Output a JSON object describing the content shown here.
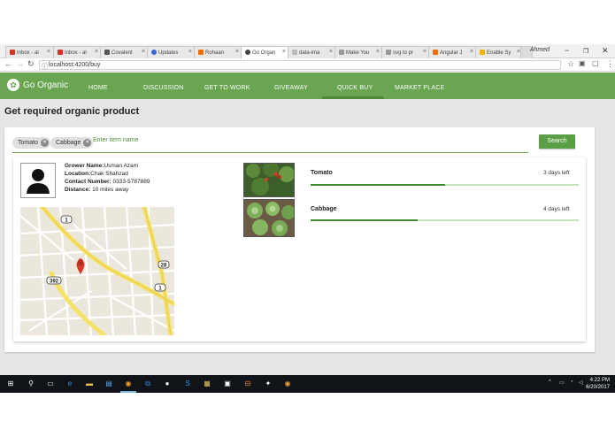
{
  "browser": {
    "tabs": [
      {
        "label": "Inbox - al",
        "color": "#d93025"
      },
      {
        "label": "Inbox - al",
        "color": "#d93025"
      },
      {
        "label": "Covalent",
        "color": "#555555"
      },
      {
        "label": "Updates",
        "color": "#3367d6"
      },
      {
        "label": "Rohaan",
        "color": "#e8710a"
      },
      {
        "label": "Go Organ",
        "color": "#444444"
      },
      {
        "label": "data-ima",
        "color": "#777777"
      },
      {
        "label": "Make You",
        "color": "#777777"
      },
      {
        "label": "svg to pr",
        "color": "#777777"
      },
      {
        "label": "Angular J",
        "color": "#e8710a"
      },
      {
        "label": "Enable Sy",
        "color": "#f4b400"
      }
    ],
    "profile_name": "Ahmed",
    "url": "localhost:4200/buy"
  },
  "app": {
    "logo_text": "Go Organic",
    "nav": [
      "HOME",
      "DISCUSSION",
      "GET TO WORK",
      "GIVEAWAY",
      "QUICK BUY",
      "MARKET PLACE"
    ],
    "active_nav": "QUICK BUY"
  },
  "page": {
    "title": "Get required organic product",
    "chips": [
      "Tomato",
      "Cabbage"
    ],
    "search_placeholder": "Enter item name",
    "search_button": "Search"
  },
  "grower": {
    "name_label": "Grower Name:",
    "name": "Usman Azam",
    "location_label": "Location:",
    "location": "Chak Shahzad",
    "contact_label": "Contact Number:",
    "contact": "0333-5787889",
    "distance_label": "Distance:",
    "distance": "10 miles away"
  },
  "products": [
    {
      "name": "Tomato",
      "days_left": "3 days left",
      "progress": 0.5
    },
    {
      "name": "Cabbage",
      "days_left": "4 days left",
      "progress": 0.4
    }
  ],
  "map": {
    "road_labels": [
      "1",
      "28",
      "1",
      "392"
    ]
  },
  "taskbar": {
    "time": "4:22 PM",
    "date": "6/20/2017"
  },
  "colors": {
    "brand_green": "#6aa552",
    "progress_green": "#3f8a2f"
  }
}
